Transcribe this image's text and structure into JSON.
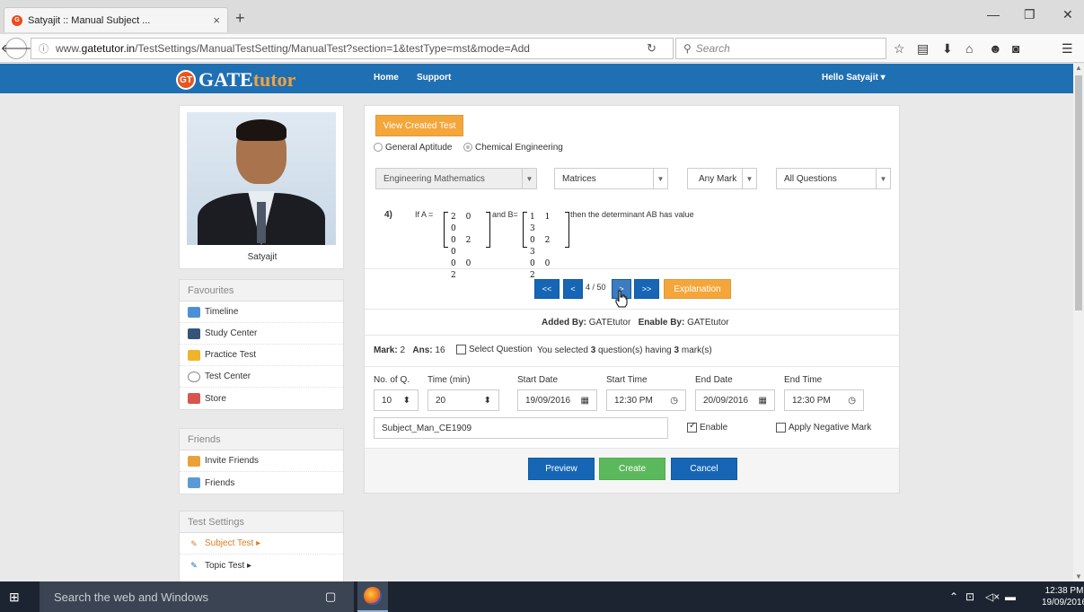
{
  "browser": {
    "tab_title": "Satyajit :: Manual Subject ...",
    "tab_close": "×",
    "new_tab": "+",
    "url_prefix": "www.",
    "url_domain": "gatetutor.in",
    "url_path": "/TestSettings/ManualTestSetting/ManualTest?section=1&testType=mst&mode=Add",
    "search_placeholder": "Search"
  },
  "site": {
    "logo_badge": "GT",
    "logo_gate": "GATE",
    "logo_tutor": "tutor",
    "nav": [
      "Home",
      "Support"
    ],
    "greeting": "Hello Satyajit ▾"
  },
  "sidebar": {
    "profile_name": "Satyajit",
    "favourites": {
      "title": "Favourites",
      "items": [
        "Timeline",
        "Study Center",
        "Practice Test",
        "Test Center",
        "Store"
      ]
    },
    "friends": {
      "title": "Friends",
      "items": [
        "Invite Friends",
        "Friends"
      ]
    },
    "test_settings": {
      "title": "Test Settings",
      "items": [
        "Subject Test ▸",
        "Topic Test ▸"
      ]
    }
  },
  "main": {
    "view_created_test": "View Created Test",
    "radio_options": [
      "General Aptitude",
      "Chemical Engineering"
    ],
    "filters": {
      "subject": "Engineering Mathematics",
      "topic": "Matrices",
      "mark": "Any Mark",
      "questions": "All Questions"
    },
    "question": {
      "number": "4)",
      "prefix": "If A =",
      "matrix_a": [
        "2  0  0",
        "0  2  0",
        "0  0  2"
      ],
      "middle": "and  B=",
      "matrix_b": [
        "1  1  3",
        "0  2  3",
        "0  0  2"
      ],
      "suffix": "then the determinant AB has value"
    },
    "pager": {
      "first": "<<",
      "prev": "<",
      "status": "4 / 50",
      "next": ">",
      "last": ">>",
      "explanation": "Explanation"
    },
    "added_by_label": "Added By:",
    "added_by_value": "GATEtutor",
    "enable_by_label": "Enable By:",
    "enable_by_value": "GATEtutor",
    "mark_label": "Mark:",
    "mark_value": "2",
    "ans_label": "Ans:",
    "ans_value": "16",
    "select_question": "Select Question",
    "selected_prefix": "You selected",
    "selected_count": "3",
    "selected_middle": "question(s) having",
    "selected_marks": "3",
    "selected_suffix": "mark(s)",
    "settings": {
      "no_of_q_label": "No. of Q.",
      "no_of_q": "10",
      "time_label": "Time (min)",
      "time": "20",
      "start_date_label": "Start Date",
      "start_date": "19/09/2016",
      "start_time_label": "Start Time",
      "start_time": "12:30 PM",
      "end_date_label": "End Date",
      "end_date": "20/09/2016",
      "end_time_label": "End Time",
      "end_time": "12:30 PM"
    },
    "test_name": "Subject_Man_CE1909",
    "enable_label": "Enable",
    "enable_checked": true,
    "negative_label": "Apply Negative Mark",
    "buttons": {
      "preview": "Preview",
      "create": "Create",
      "cancel": "Cancel"
    }
  },
  "taskbar": {
    "search": "Search the web and Windows",
    "time": "12:38 PM",
    "date": "19/09/2016"
  }
}
